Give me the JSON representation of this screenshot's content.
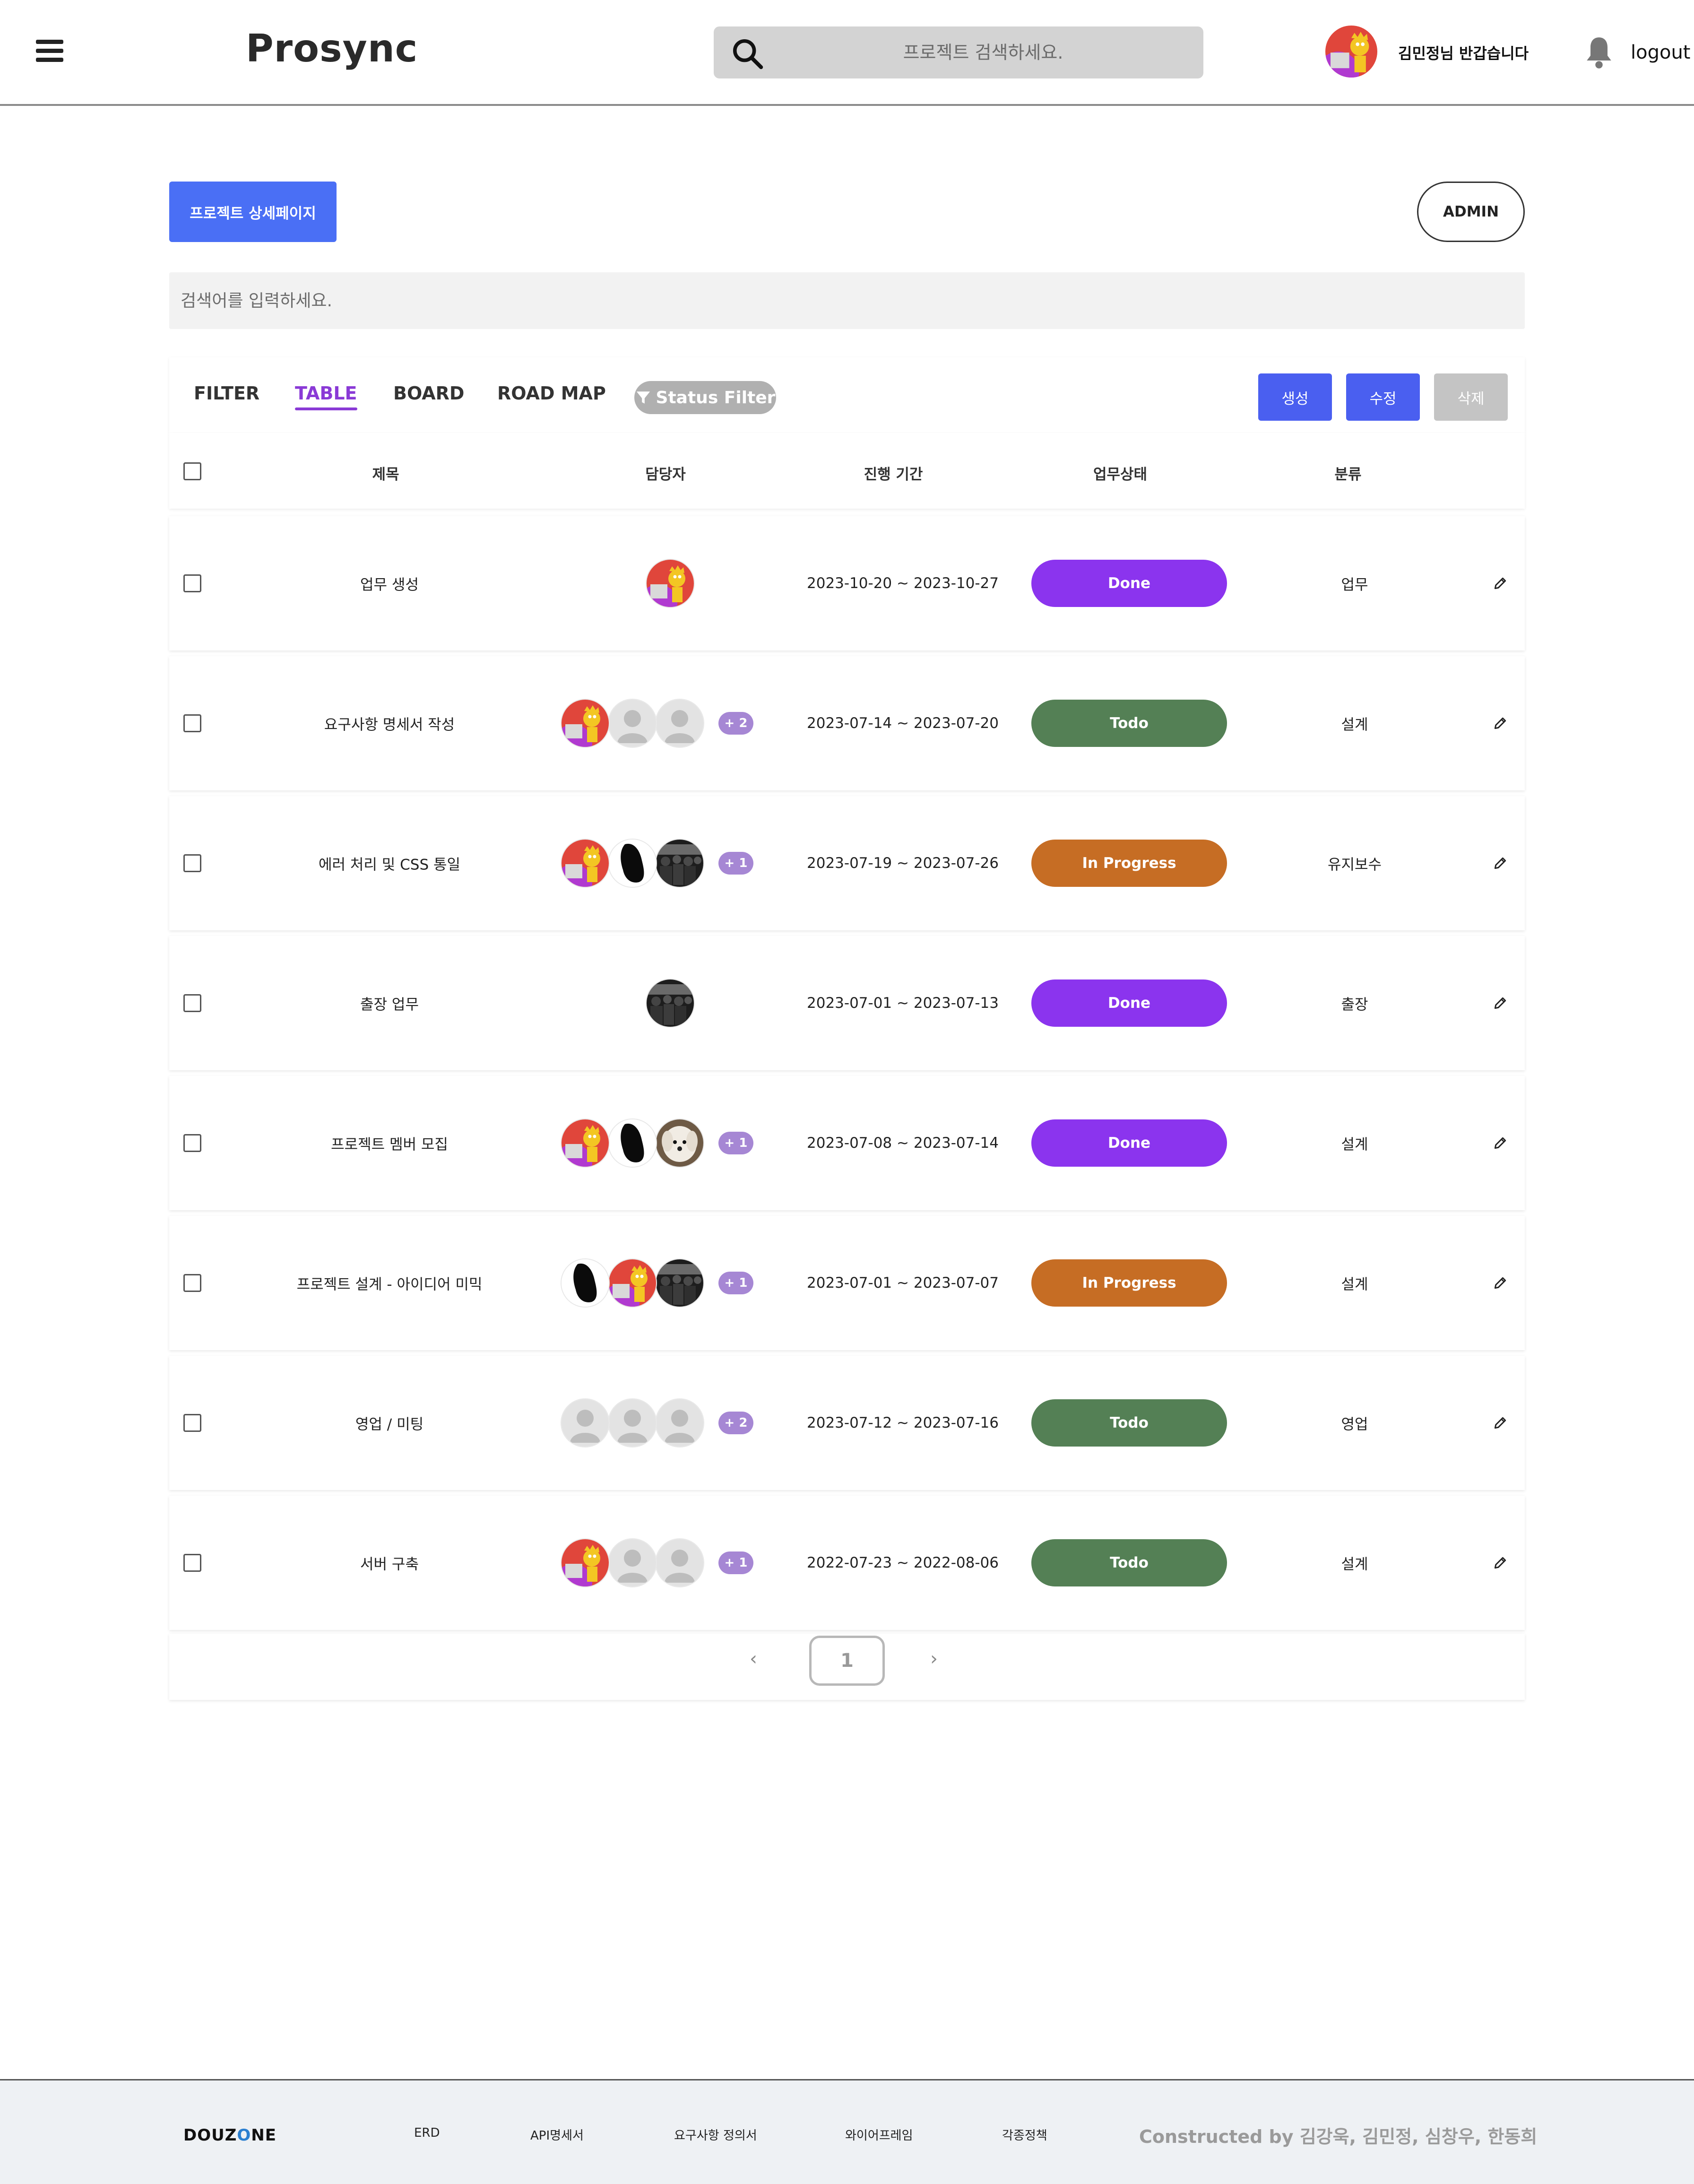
{
  "header": {
    "brand": "Prosync",
    "search_placeholder": "프로젝트 검색하세요.",
    "greeting": "김민정님 반갑습니다",
    "logout": "logout"
  },
  "toolbar": {
    "detail_button": "프로젝트 상세페이지",
    "admin_button": "ADMIN",
    "search_placeholder": "검색어를 입력하세요."
  },
  "tabs": [
    "FILTER",
    "TABLE",
    "BOARD",
    "ROAD MAP"
  ],
  "active_tab": "TABLE",
  "status_filter": "Status Filter",
  "actions": {
    "create": "생성",
    "edit": "수정",
    "delete": "삭제"
  },
  "columns": [
    "제목",
    "담당자",
    "진행 기간",
    "업무상태",
    "분류"
  ],
  "rows": [
    {
      "title": "업무 생성",
      "avatars": [
        "simpson"
      ],
      "extra": "",
      "period": "2023-10-20 ~ 2023-10-27",
      "status": "Done",
      "category": "업무"
    },
    {
      "title": "요구사항 명세서 작성",
      "avatars": [
        "simpson",
        "default",
        "default"
      ],
      "extra": "+ 2",
      "period": "2023-07-14 ~ 2023-07-20",
      "status": "Todo",
      "category": "설계"
    },
    {
      "title": "에러 처리 및 CSS 통일",
      "avatars": [
        "simpson",
        "blob",
        "crowd"
      ],
      "extra": "+ 1",
      "period": "2023-07-19 ~ 2023-07-26",
      "status": "In Progress",
      "category": "유지보수"
    },
    {
      "title": "출장 업무",
      "avatars": [
        "crowd"
      ],
      "extra": "",
      "period": "2023-07-01 ~ 2023-07-13",
      "status": "Done",
      "category": "출장"
    },
    {
      "title": "프로젝트 멤버 모집",
      "avatars": [
        "simpson",
        "blob",
        "dog"
      ],
      "extra": "+ 1",
      "period": "2023-07-08 ~ 2023-07-14",
      "status": "Done",
      "category": "설계"
    },
    {
      "title": "프로젝트 설계 - 아이디어 미믹",
      "avatars": [
        "blob",
        "simpson",
        "crowd"
      ],
      "extra": "+ 1",
      "period": "2023-07-01 ~ 2023-07-07",
      "status": "In Progress",
      "category": "설계"
    },
    {
      "title": "영업 / 미팅",
      "avatars": [
        "default",
        "default",
        "default"
      ],
      "extra": "+ 2",
      "period": "2023-07-12 ~ 2023-07-16",
      "status": "Todo",
      "category": "영업"
    },
    {
      "title": "서버 구축",
      "avatars": [
        "simpson",
        "default",
        "default"
      ],
      "extra": "+ 1",
      "period": "2022-07-23 ~ 2022-08-06",
      "status": "Todo",
      "category": "설계"
    }
  ],
  "pagination": {
    "prev": "‹",
    "current": "1",
    "next": "›"
  },
  "footer": {
    "logo_prefix": "DOUZ",
    "logo_o": "O",
    "logo_suffix": "NE",
    "links": [
      "ERD",
      "API명세서",
      "요구사항 정의서",
      "와이어프레임",
      "각종정책"
    ],
    "credit": "Constructed by 김강욱, 김민정, 심창우, 한동희"
  },
  "colors": {
    "accent": "#4a6ff5",
    "tab_active": "#8a3ad6",
    "done": "#8b34ee",
    "todo": "#548055",
    "in_progress": "#c66d24"
  }
}
